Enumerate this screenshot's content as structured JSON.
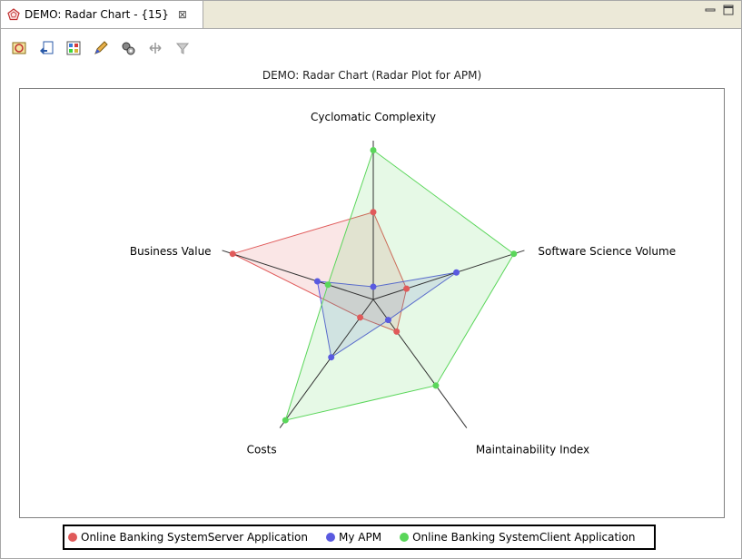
{
  "tab": {
    "title": "DEMO: Radar Chart - {15}",
    "close_glyph": "⊠"
  },
  "toolbar": {
    "icons": [
      "refresh-icon",
      "export-icon",
      "layout-icon",
      "edit-icon",
      "settings-icon",
      "zoom-icon",
      "filter-icon"
    ]
  },
  "chart_data": {
    "type": "radar",
    "title": "DEMO: Radar Chart (Radar Plot for APM)",
    "axes": [
      "Cyclomatic Complexity",
      "Software Science Volume",
      "Maintainability Index",
      "Costs",
      "Business Value"
    ],
    "range": [
      0,
      1
    ],
    "grid": false,
    "legend_position": "bottom",
    "series": [
      {
        "name": "Online Banking SystemServer Application",
        "color": "#e05a5a",
        "values": [
          0.55,
          0.22,
          0.25,
          0.14,
          0.93
        ]
      },
      {
        "name": "My APM",
        "color": "#5a5ae0",
        "values": [
          0.08,
          0.55,
          0.16,
          0.45,
          0.37
        ]
      },
      {
        "name": "Online Banking SystemClient Application",
        "color": "#5ad65a",
        "values": [
          0.94,
          0.93,
          0.67,
          0.94,
          0.3
        ]
      }
    ]
  }
}
